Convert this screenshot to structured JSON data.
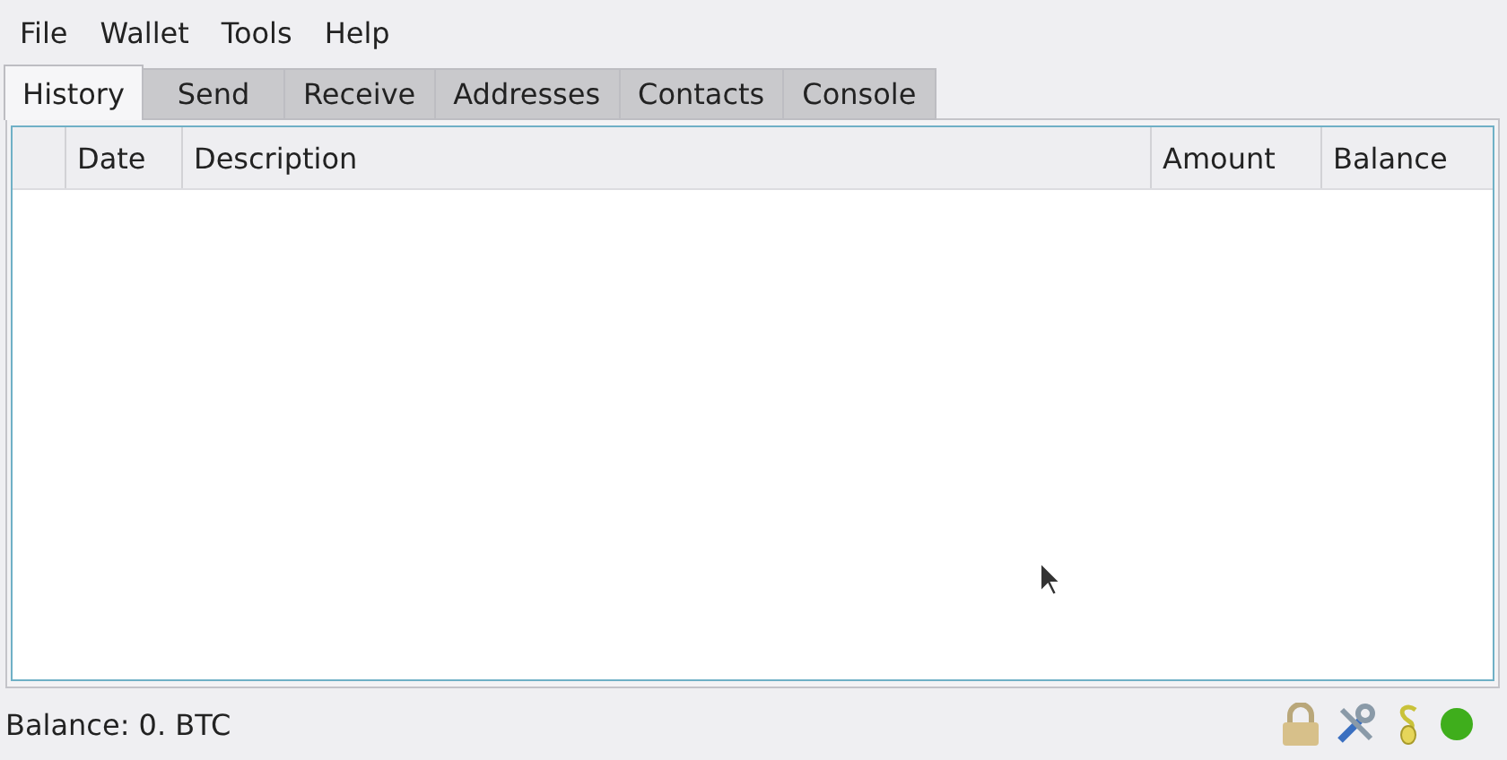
{
  "menu": [
    "File",
    "Wallet",
    "Tools",
    "Help"
  ],
  "tabs": [
    {
      "label": "History",
      "selected": true
    },
    {
      "label": "Send",
      "selected": false
    },
    {
      "label": "Receive",
      "selected": false
    },
    {
      "label": "Addresses",
      "selected": false
    },
    {
      "label": "Contacts",
      "selected": false
    },
    {
      "label": "Console",
      "selected": false
    }
  ],
  "table": {
    "columns": [
      "",
      "Date",
      "Description",
      "Amount",
      "Balance"
    ]
  },
  "status_bar": {
    "balance": "Balance: 0. BTC",
    "connected": true
  }
}
